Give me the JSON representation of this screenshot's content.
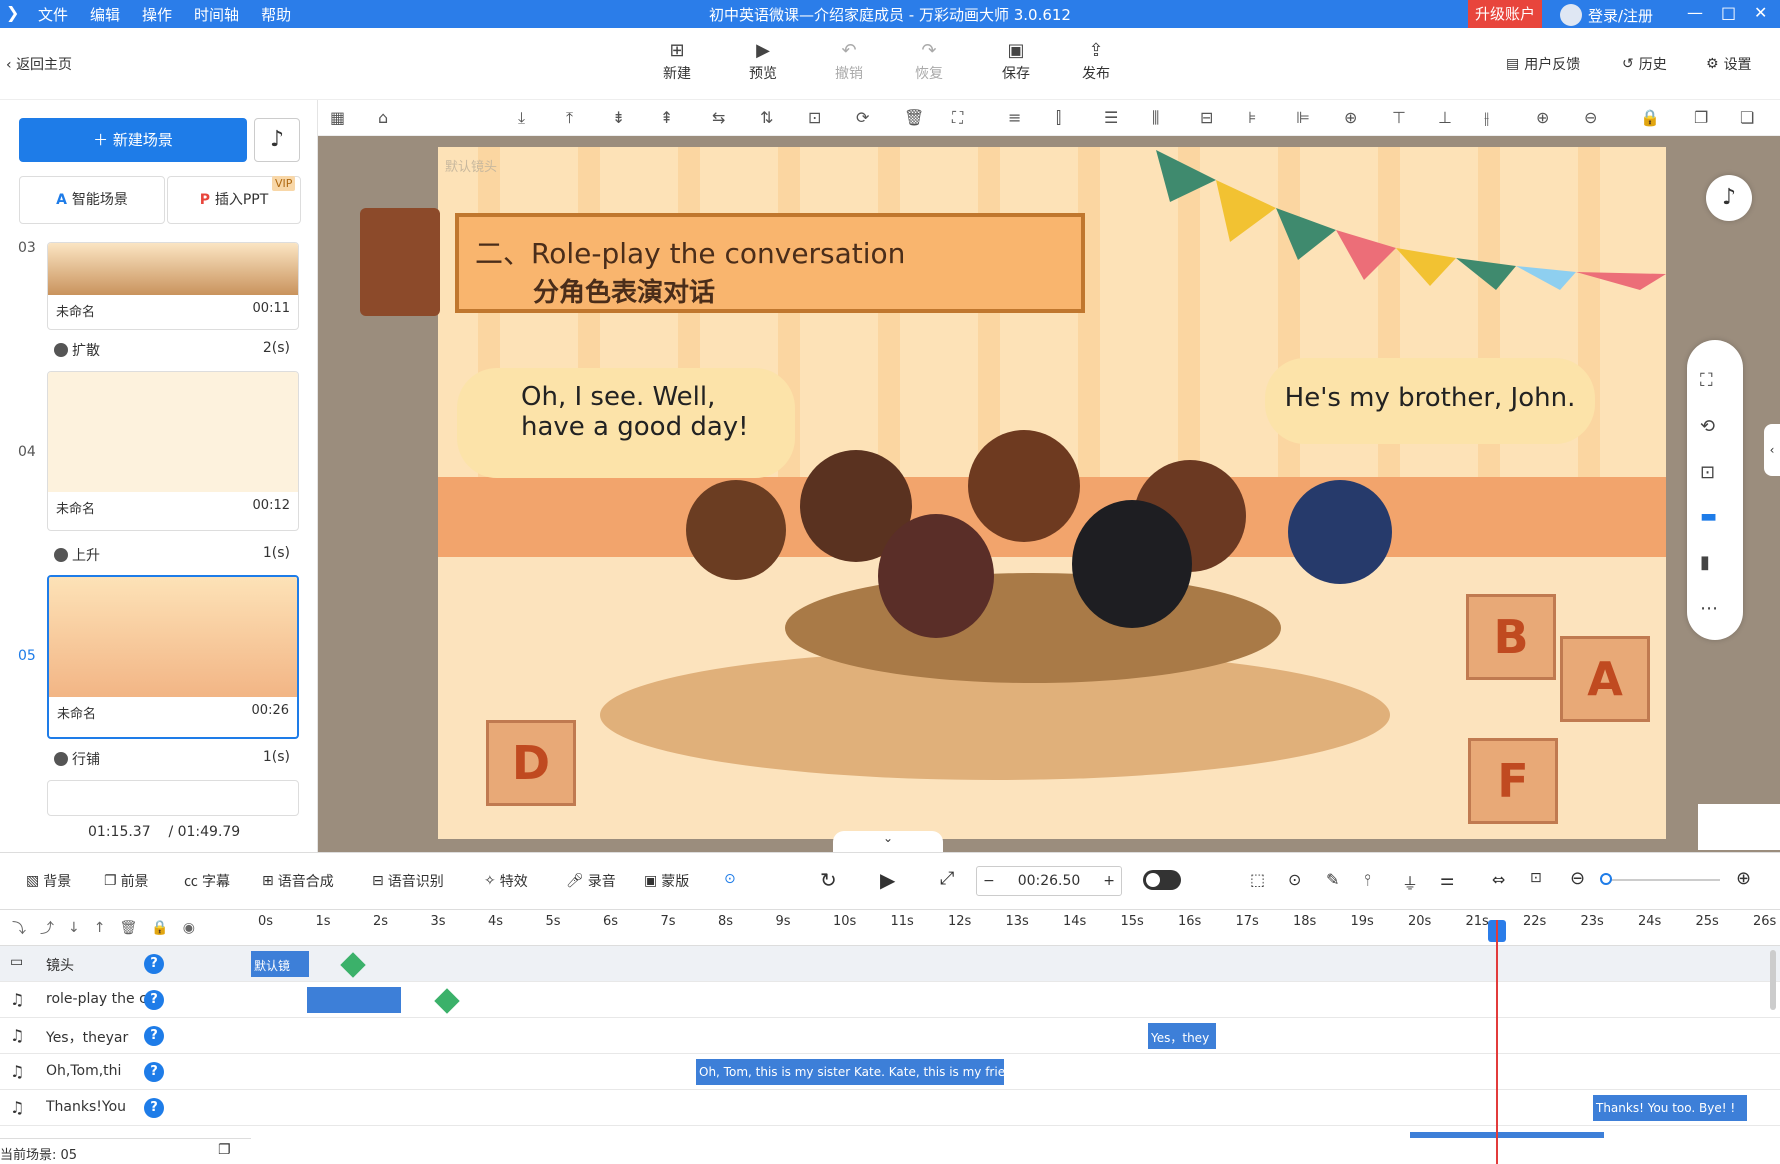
{
  "window": {
    "menu": [
      "文件",
      "编辑",
      "操作",
      "时间轴",
      "帮助"
    ],
    "title": "初中英语微课—介绍家庭成员 - 万彩动画大师 3.0.612",
    "upgrade": "升级账户",
    "login": "登录/注册",
    "controls": [
      "—",
      "□",
      "✕"
    ]
  },
  "toolbar": {
    "back": "返回主页",
    "actions": [
      "新建",
      "预览",
      "撤销",
      "恢复",
      "保存",
      "发布"
    ],
    "right": [
      "用户反馈",
      "历史",
      "设置"
    ]
  },
  "sidebar": {
    "new_scene": "新建场景",
    "smart_scene": "智能场景",
    "insert_ppt": "插入PPT",
    "vip": "VIP",
    "scenes": [
      {
        "num": "03",
        "name": "未命名",
        "duration": "00:11"
      },
      {
        "num": "04",
        "name": "未命名",
        "duration": "00:12"
      },
      {
        "num": "05",
        "name": "未命名",
        "duration": "00:26"
      }
    ],
    "transitions": [
      {
        "name": "扩散",
        "dur": "2(s)"
      },
      {
        "name": "上升",
        "dur": "1(s)"
      },
      {
        "name": "行铺",
        "dur": "1(s)"
      }
    ],
    "current_time": "01:15.37",
    "total_time": "/ 01:49.79"
  },
  "canvas": {
    "default_camera": "默认镜头",
    "title_en": "二、Role-play the conversation",
    "title_cn": "分角色表演对话",
    "bubble_left": [
      "Oh, I see. Well,",
      "have a good day!"
    ],
    "bubble_right": "He's my brother, John.",
    "blocks": [
      "D",
      "B",
      "A",
      "F"
    ]
  },
  "bottombar": {
    "tools": [
      "背景",
      "前景",
      "字幕",
      "语音合成",
      "语音识别",
      "特效",
      "录音",
      "蒙版"
    ],
    "time": "00:26.50"
  },
  "timeline": {
    "ticks": [
      "0s",
      "1s",
      "2s",
      "3s",
      "4s",
      "5s",
      "6s",
      "7s",
      "8s",
      "9s",
      "10s",
      "11s",
      "12s",
      "13s",
      "14s",
      "15s",
      "16s",
      "17s",
      "18s",
      "19s",
      "20s",
      "21s",
      "22s",
      "23s",
      "24s",
      "25s",
      "26s"
    ],
    "tracks": [
      {
        "name": "镜头",
        "clip": "默认镜"
      },
      {
        "name": "role-play the conv",
        "clip": ""
      },
      {
        "name": "Yes，theyar",
        "clip": "Yes，they"
      },
      {
        "name": "Oh,Tom,thi",
        "clip": "Oh, Tom, this is my sister Kate. Kate, this is my frie"
      },
      {
        "name": "Thanks!You",
        "clip": "Thanks! You too. Bye! !"
      }
    ],
    "current_scene": "当前场景: 05"
  },
  "colors": {
    "accent": "#2b7de9",
    "upgrade": "#e8453c",
    "playhead": "#e23b3b"
  }
}
